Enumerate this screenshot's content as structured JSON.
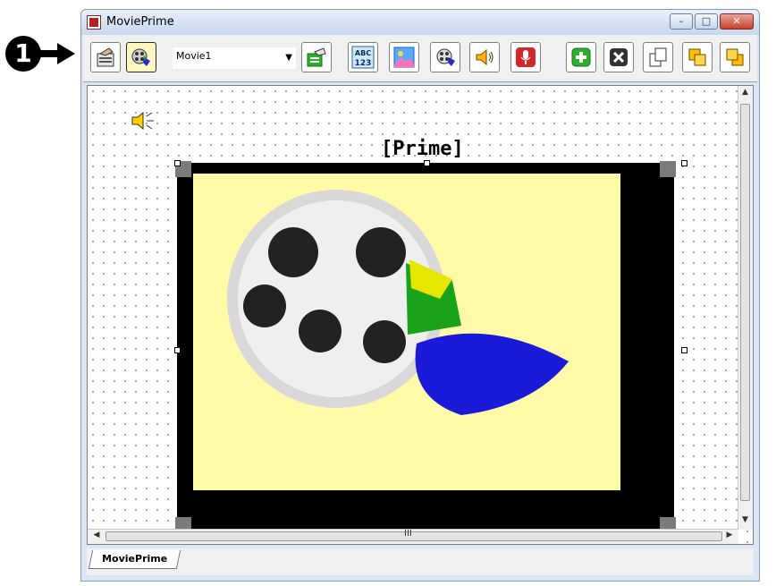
{
  "callout": {
    "number": "1"
  },
  "window": {
    "title": "MoviePrime"
  },
  "toolbar": {
    "clip_selector": "Movie1",
    "buttons": [
      {
        "name": "edit-frame-icon"
      },
      {
        "name": "movie-clip-icon",
        "pressed": true
      },
      {
        "name": "select-clip-icon"
      },
      {
        "name": "text-abc-123-icon",
        "text": "ABC\n123"
      },
      {
        "name": "image-icon"
      },
      {
        "name": "film-reel-icon"
      },
      {
        "name": "speaker-sound-icon"
      },
      {
        "name": "record-microphone-icon"
      },
      {
        "name": "add-icon"
      },
      {
        "name": "delete-icon"
      },
      {
        "name": "copy-pages-icon"
      },
      {
        "name": "bring-forward-icon"
      },
      {
        "name": "send-back-icon"
      }
    ]
  },
  "canvas": {
    "label": "[Prime]"
  },
  "tabs": [
    {
      "label": "MoviePrime",
      "active": true
    }
  ],
  "colors": {
    "accent": "#fffaa8",
    "window_close": "#c6412d"
  }
}
